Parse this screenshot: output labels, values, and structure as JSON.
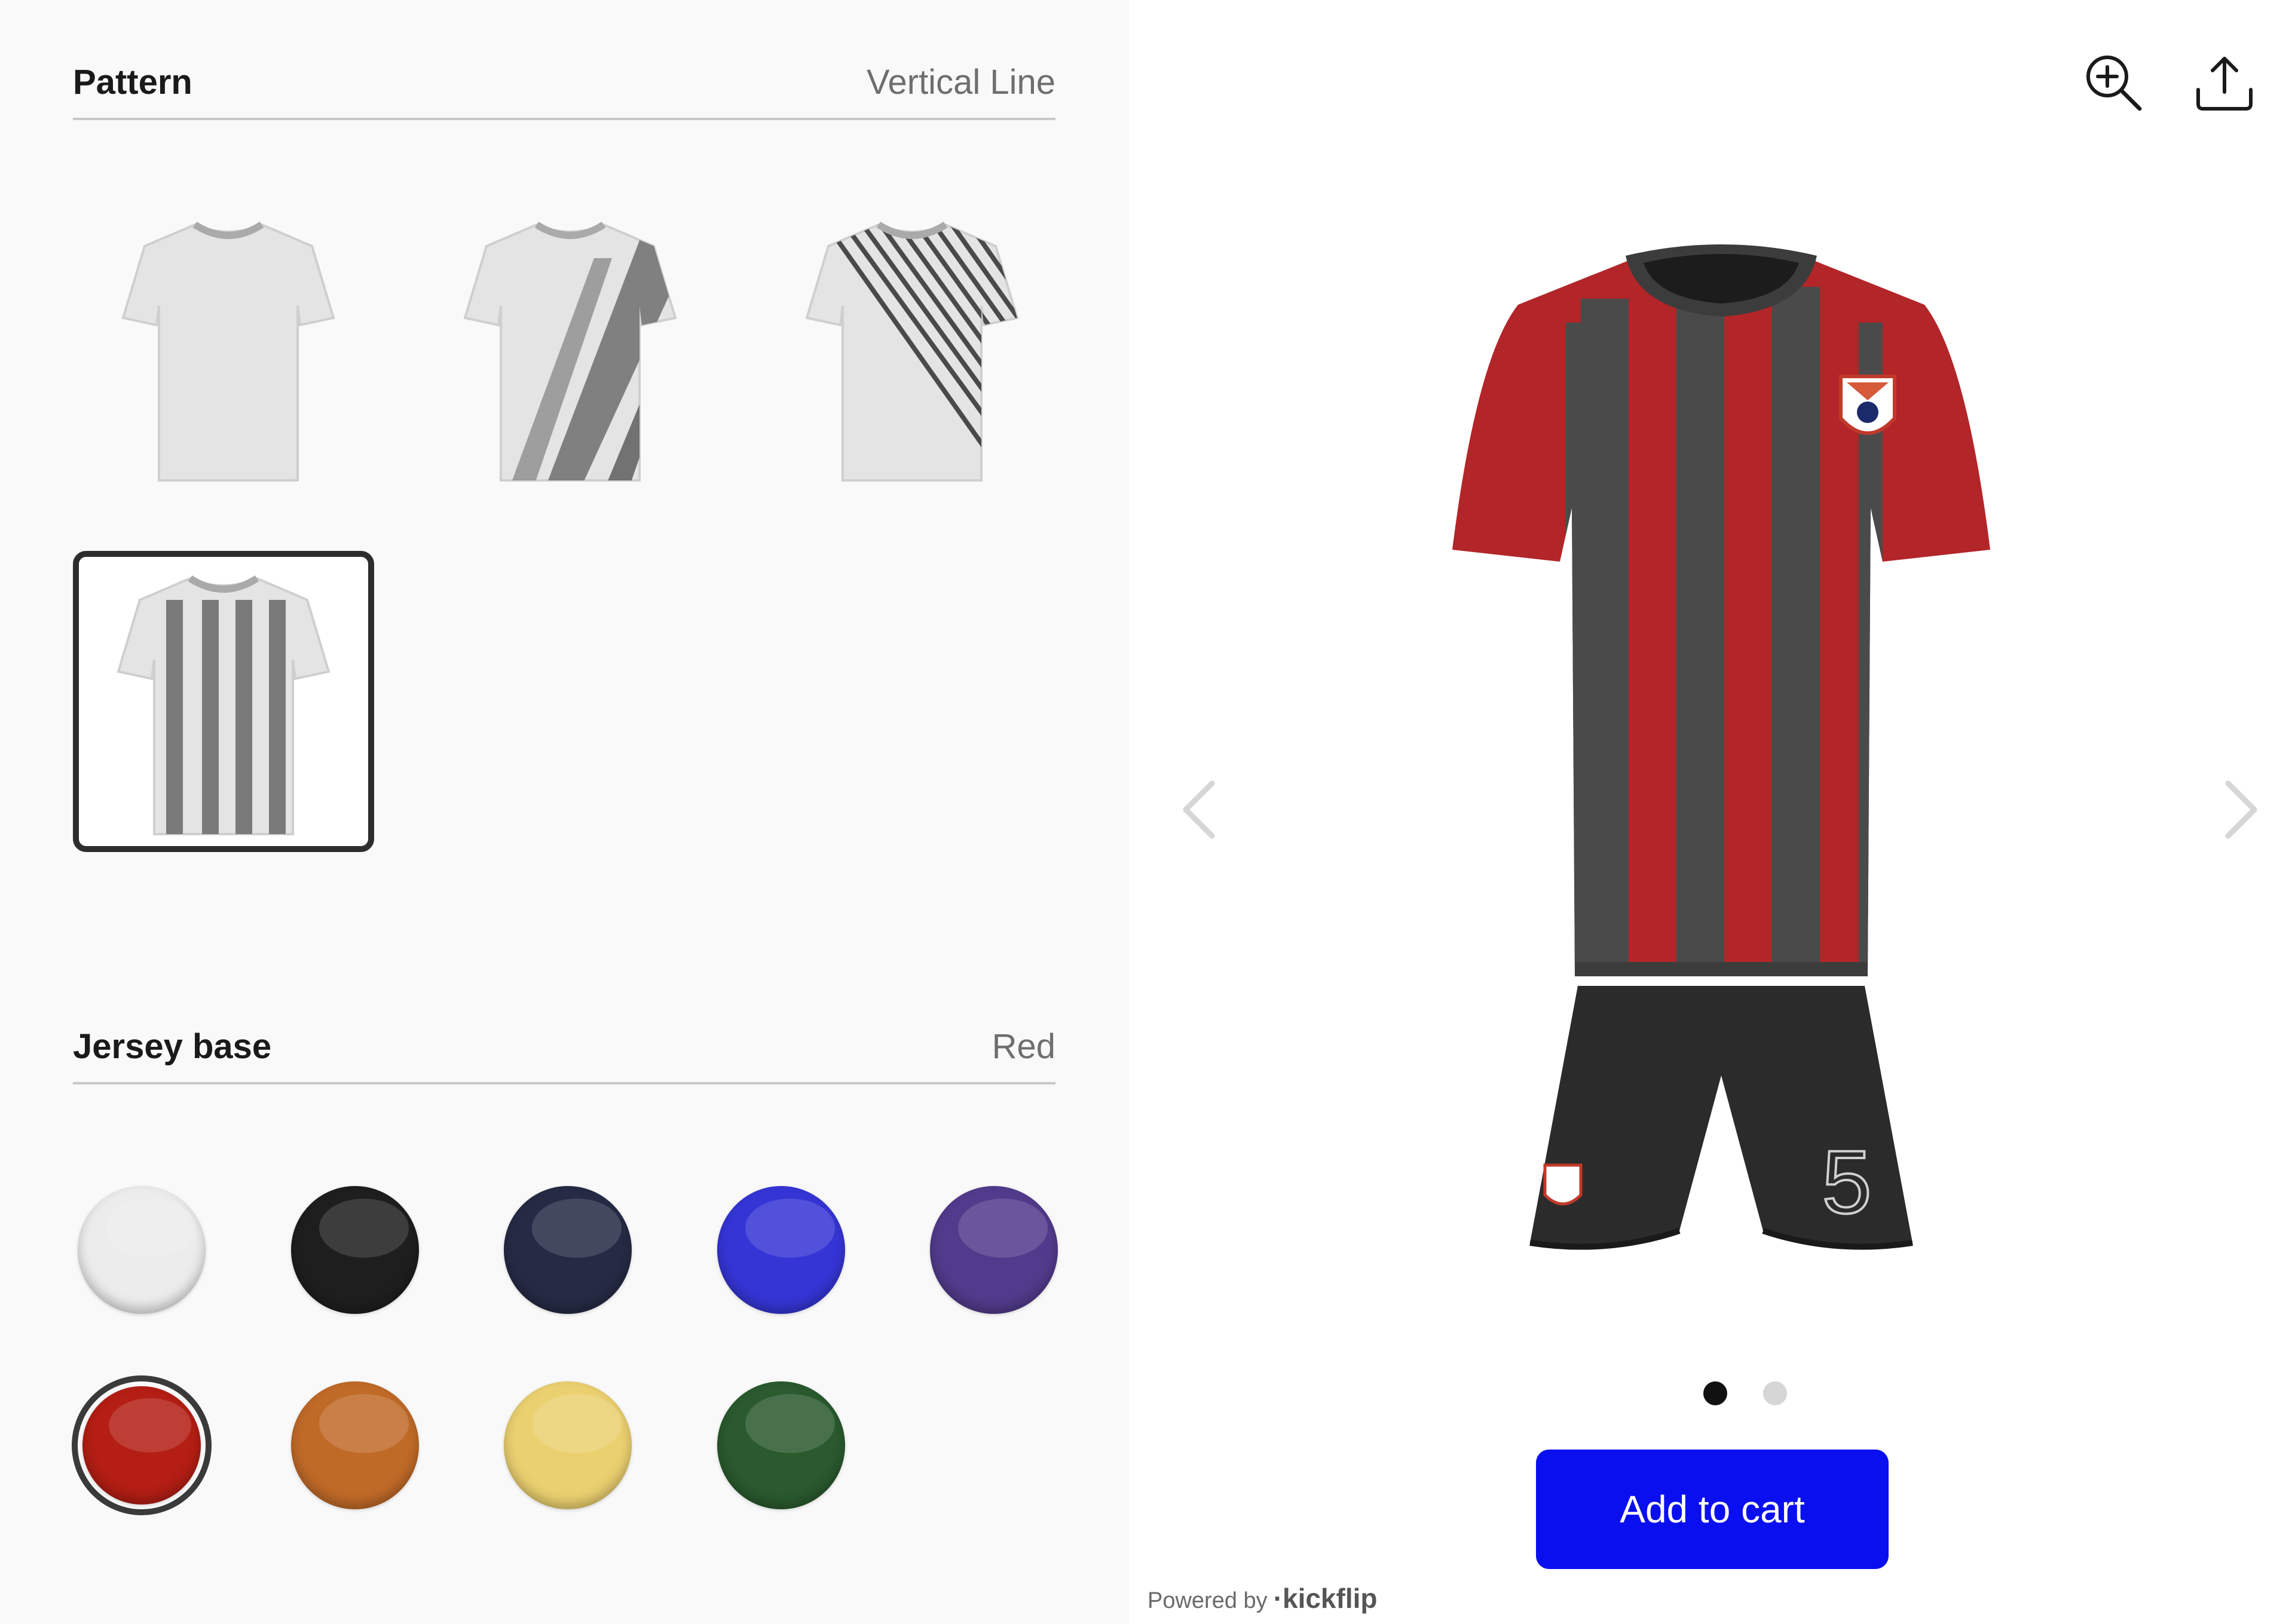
{
  "pattern": {
    "title": "Pattern",
    "selected_value": "Vertical Line",
    "options": [
      {
        "name": "plain",
        "selected": false
      },
      {
        "name": "diagonal-brush",
        "selected": false
      },
      {
        "name": "diagonal-lines",
        "selected": false
      },
      {
        "name": "vertical-line",
        "selected": true
      }
    ]
  },
  "jersey_base": {
    "title": "Jersey base",
    "selected_value": "Red",
    "swatches": [
      {
        "color": "#ececec",
        "selected": false
      },
      {
        "color": "#1e1e1e",
        "selected": false
      },
      {
        "color": "#262b45",
        "selected": false
      },
      {
        "color": "#3535d6",
        "selected": false
      },
      {
        "color": "#523b8c",
        "selected": false
      },
      {
        "color": "#b41e14",
        "selected": true
      },
      {
        "color": "#c06a28",
        "selected": false
      },
      {
        "color": "#ebd070",
        "selected": false
      },
      {
        "color": "#2a5a2e",
        "selected": false
      }
    ]
  },
  "toolbar": {
    "zoom_icon": "zoom-in-icon",
    "share_icon": "upload-share-icon"
  },
  "preview": {
    "jersey_color": "#b22528",
    "stripe_color": "#4a4a4a",
    "shorts_color": "#2b2b2b",
    "number": "5",
    "dots": [
      {
        "active": true
      },
      {
        "active": false
      }
    ]
  },
  "cart": {
    "add_label": "Add to cart",
    "accent": "#0a0ff0"
  },
  "footer": {
    "powered_by": "Powered by",
    "brand": "·kickflip"
  }
}
